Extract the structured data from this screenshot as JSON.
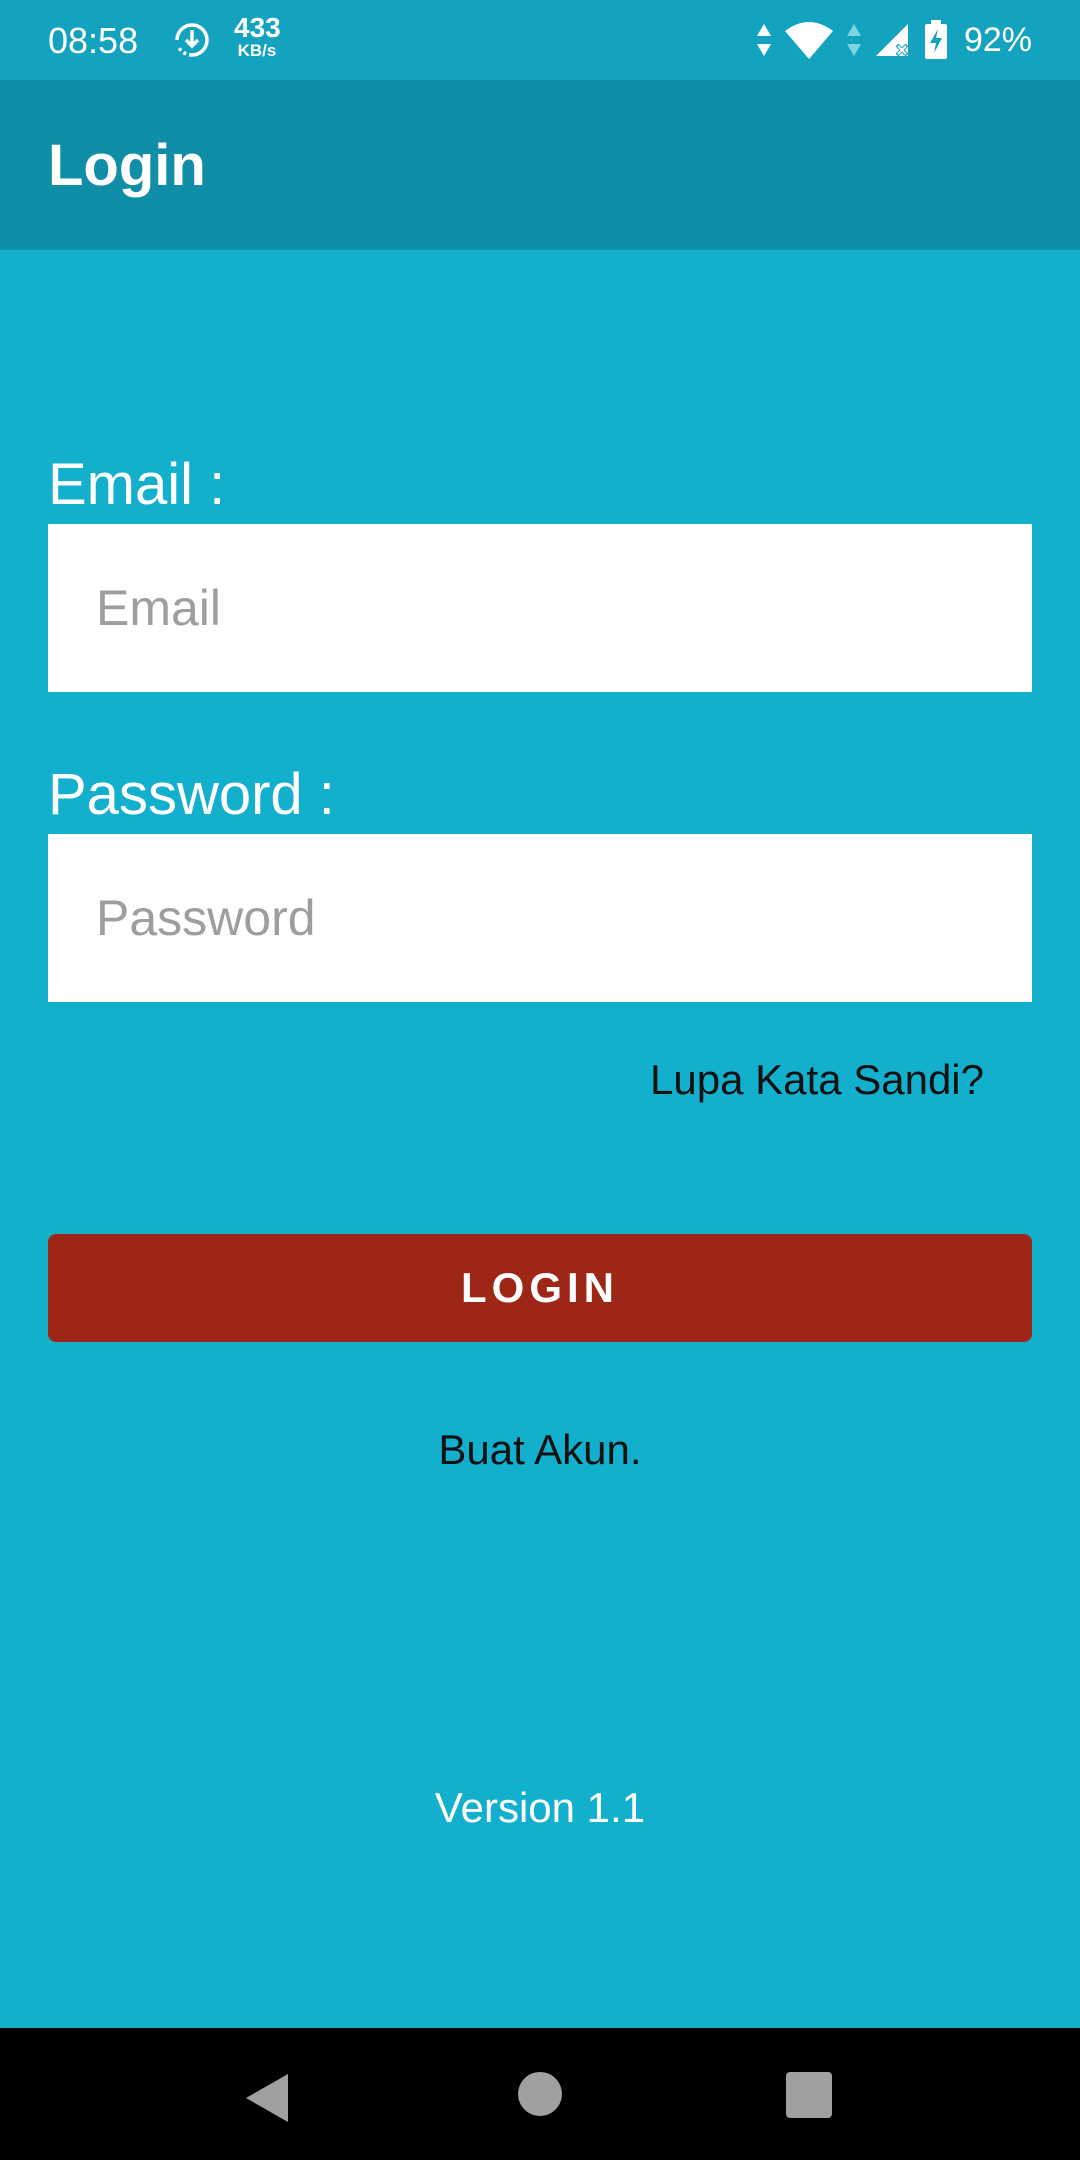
{
  "status_bar": {
    "time": "08:58",
    "download_speed_value": "433",
    "download_speed_unit": "KB/s",
    "battery_percent": "92%",
    "icons": [
      "download-progress-icon",
      "data-transfer-arrows-icon",
      "wifi-icon",
      "cell-signal-icon",
      "battery-charging-icon"
    ]
  },
  "app_bar": {
    "title": "Login"
  },
  "form": {
    "email_label": "Email :",
    "email_placeholder": "Email",
    "password_label": "Password :",
    "password_placeholder": "Password",
    "forgot_password": "Lupa Kata Sandi?",
    "login_button": "LOGIN",
    "create_account": "Buat Akun."
  },
  "footer": {
    "version": "Version 1.1"
  },
  "nav_bar": {
    "icons": [
      "back-icon",
      "home-icon",
      "recents-icon"
    ]
  },
  "colors": {
    "background": "#13b0ce",
    "status_bar": "#13a3bf",
    "app_bar": "#108ea7",
    "login_button": "#9e2617",
    "input_background": "#ffffff"
  }
}
